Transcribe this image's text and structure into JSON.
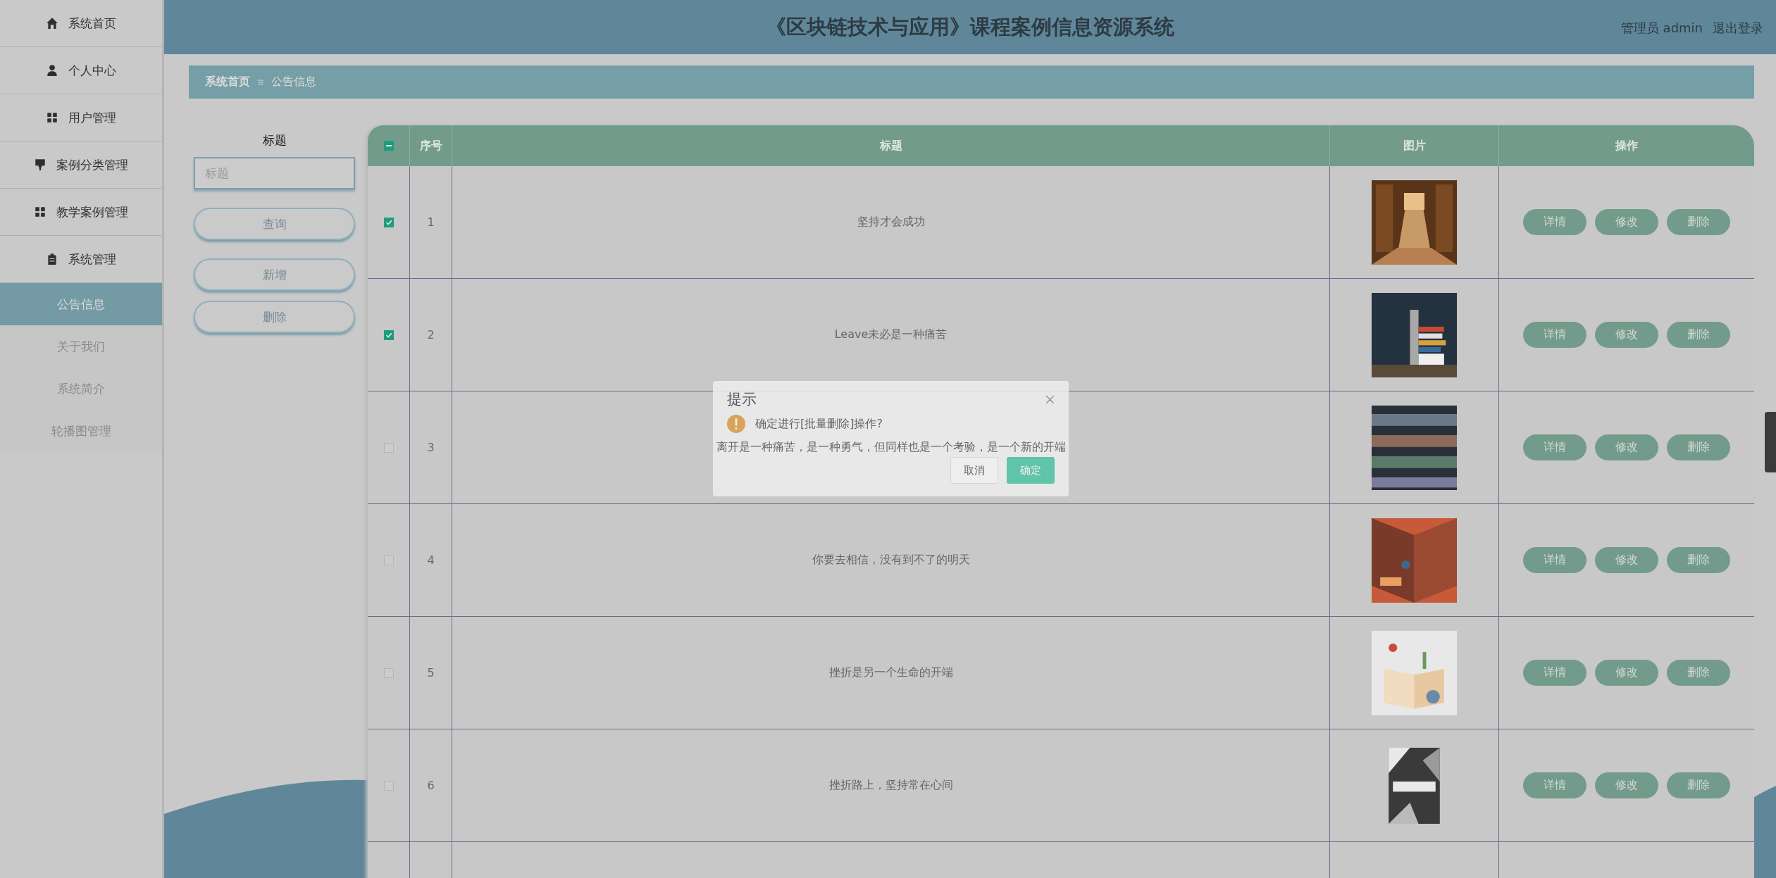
{
  "sidebar": {
    "items": [
      {
        "label": "系统首页",
        "kind": "menu",
        "selected": false
      },
      {
        "label": "个人中心",
        "kind": "menu",
        "selected": false
      },
      {
        "label": "用户管理",
        "kind": "menu",
        "selected": false
      },
      {
        "label": "案例分类管理",
        "kind": "menu",
        "selected": false
      },
      {
        "label": "教学案例管理",
        "kind": "menu",
        "selected": false
      },
      {
        "label": "系统管理",
        "kind": "menu",
        "selected": false
      },
      {
        "label": "公告信息",
        "kind": "submenu",
        "selected": true
      },
      {
        "label": "关于我们",
        "kind": "submenu",
        "selected": false
      },
      {
        "label": "系统简介",
        "kind": "submenu",
        "selected": false
      },
      {
        "label": "轮播图管理",
        "kind": "submenu",
        "selected": false
      }
    ]
  },
  "header": {
    "title": "《区块链技术与应用》课程案例信息资源系统",
    "user": "管理员 admin",
    "logout": "退出登录"
  },
  "breadcrumb": {
    "home": "系统首页",
    "current": "公告信息"
  },
  "search": {
    "label": "标题",
    "placeholder": "标题",
    "buttons": [
      "查询",
      "新增",
      "删除"
    ]
  },
  "table": {
    "select_all_indeterminate": true,
    "columns": [
      "序号",
      "标题",
      "图片",
      "操作"
    ],
    "rows": [
      {
        "index": "1",
        "title": "坚持才会成功",
        "checked": true,
        "actions": [
          "详情",
          "修改",
          "删除"
        ]
      },
      {
        "index": "2",
        "title": "Leave未必是一种痛苦",
        "checked": true,
        "actions": [
          "详情",
          "修改",
          "删除"
        ]
      },
      {
        "index": "3",
        "title": "离开是一种痛苦，是一种勇气，但同样也是一个考验，是一个新的开端",
        "checked": false,
        "actions": [
          "详情",
          "修改",
          "删除"
        ]
      },
      {
        "index": "4",
        "title": "你要去相信，没有到不了的明天",
        "checked": false,
        "actions": [
          "详情",
          "修改",
          "删除"
        ]
      },
      {
        "index": "5",
        "title": "挫折是另一个生命的开端",
        "checked": false,
        "actions": [
          "详情",
          "修改",
          "删除"
        ]
      },
      {
        "index": "6",
        "title": "挫折路上，坚持常在心间",
        "checked": false,
        "actions": [
          "详情",
          "修改",
          "删除"
        ]
      }
    ]
  },
  "dialog": {
    "title": "提示",
    "message": "确定进行[批量删除]操作?",
    "cancel": "取消",
    "confirm": "确定"
  }
}
